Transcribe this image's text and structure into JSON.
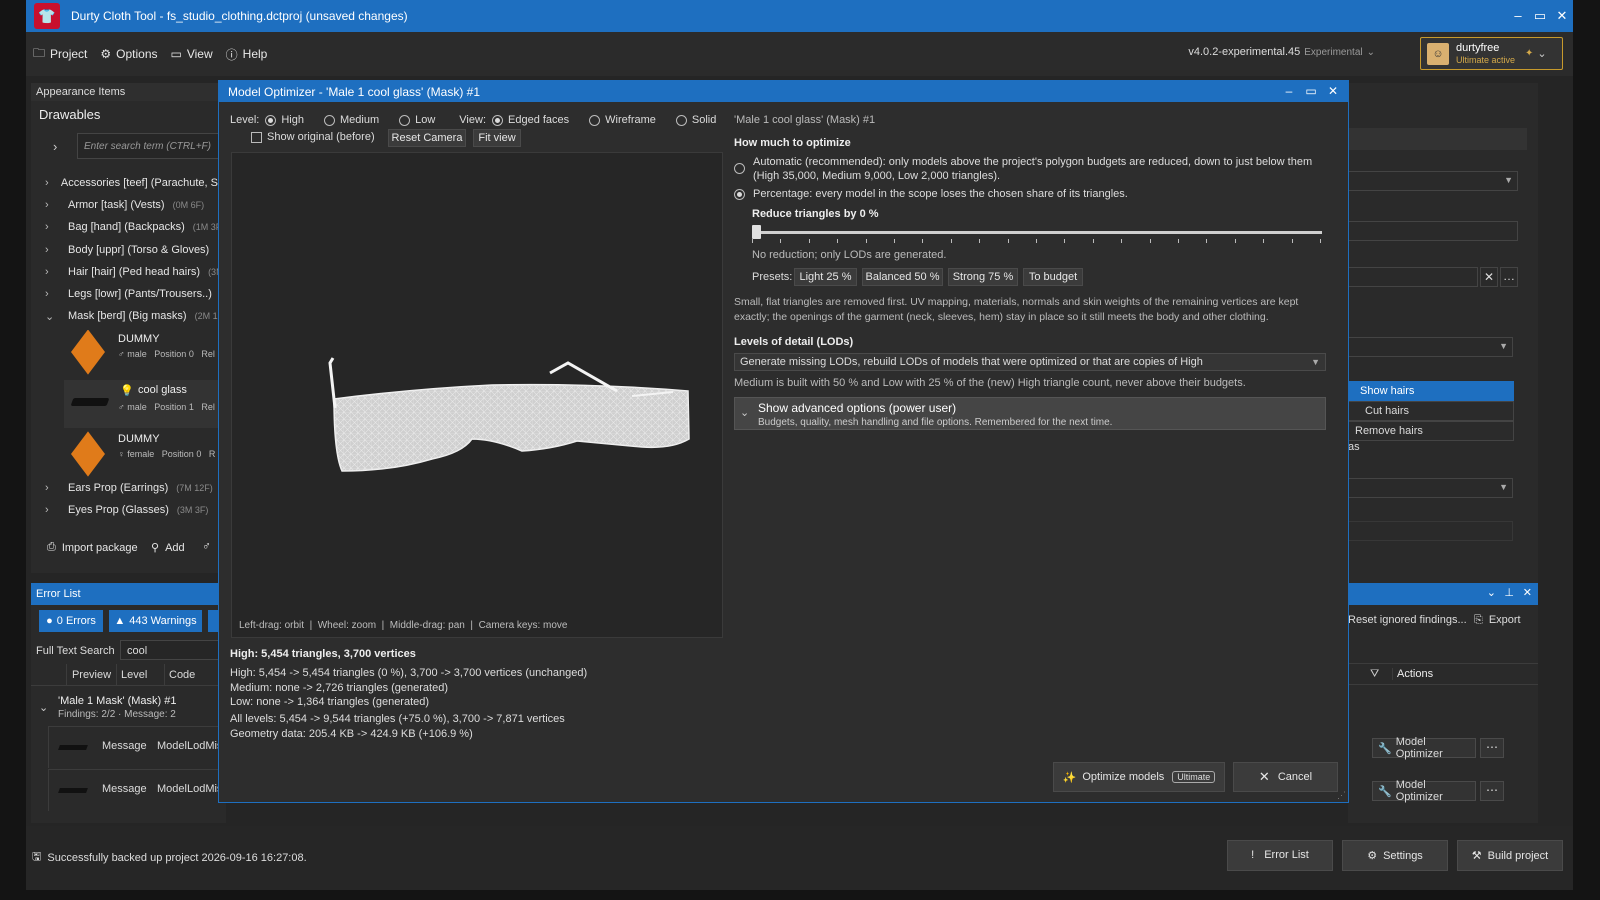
{
  "window": {
    "title": "Durty Cloth Tool - fs_studio_clothing.dctproj (unsaved changes)",
    "logo_icon": "tshirt-logo-icon",
    "controls": [
      "minimize-icon",
      "maximize-icon",
      "close-icon"
    ]
  },
  "menu": {
    "items": [
      {
        "label": "Project",
        "icon": "folder-icon"
      },
      {
        "label": "Options",
        "icon": "gear-icon"
      },
      {
        "label": "View",
        "icon": "view-icon"
      },
      {
        "label": "Help",
        "icon": "info-icon"
      }
    ],
    "version": "v4.0.2-experimental.45",
    "channel": "Experimental",
    "user": {
      "name": "durtyfree",
      "status": "Ultimate active"
    }
  },
  "appearance": {
    "panel_title": "Appearance Items",
    "section": "Drawables",
    "search_placeholder": "Enter search term (CTRL+F)",
    "tree": [
      {
        "label": "Accessories [teef] (Parachute, S",
        "count": ""
      },
      {
        "label": "Armor [task] (Vests)",
        "count": "(0M 6F)"
      },
      {
        "label": "Bag [hand] (Backpacks)",
        "count": "(1M 3F"
      },
      {
        "label": "Body [uppr] (Torso & Gloves)",
        "count": ""
      },
      {
        "label": "Hair [hair] (Ped head hairs)",
        "count": "(3M"
      },
      {
        "label": "Legs [lowr] (Pants/Trousers..)",
        "count": ""
      },
      {
        "label": "Mask [berd] (Big masks)",
        "count": "(2M 1F"
      }
    ],
    "cards": [
      {
        "name": "DUMMY",
        "gender": "male",
        "position_label": "Position",
        "position": "0",
        "extra": "Rel"
      },
      {
        "name": "cool glass",
        "gender": "male",
        "position_label": "Position",
        "position": "1",
        "extra": "Rel"
      },
      {
        "name": "DUMMY",
        "gender": "female",
        "position_label": "Position",
        "position": "0",
        "extra": "R"
      }
    ],
    "tree_after": [
      {
        "label": "Ears Prop (Earrings)",
        "count": "(7M 12F)"
      },
      {
        "label": "Eyes Prop (Glasses)",
        "count": "(3M 3F)"
      }
    ],
    "actions": {
      "import": "Import package",
      "add": "Add"
    }
  },
  "errors": {
    "panel_title": "Error List",
    "errors_btn": "0 Errors",
    "warnings_btn": "443 Warnings",
    "search_label": "Full Text Search",
    "search_value": "cool",
    "columns": [
      "Preview",
      "Level",
      "Code"
    ],
    "group": {
      "title": "'Male 1 Mask' (Mask) #1",
      "sub": "Findings: 2/2 · Message: 2"
    },
    "rows": [
      {
        "level": "Message",
        "code": "ModelLodMis"
      },
      {
        "level": "Message",
        "code": "ModelLodMis"
      }
    ],
    "right": {
      "reset": "Reset ignored findings...",
      "export": "Export",
      "actions_header": "Actions",
      "row_action": "Model Optimizer"
    }
  },
  "right_panel": {
    "dropdown_items": [
      "Show hairs",
      "Cut hairs",
      "Remove hairs"
    ],
    "fragment": "as"
  },
  "dialog": {
    "title": "Model Optimizer - 'Male 1 cool glass' (Mask) #1",
    "level_label": "Level:",
    "levels": [
      "High",
      "Medium",
      "Low"
    ],
    "view_label": "View:",
    "views": [
      "Edged faces",
      "Wireframe",
      "Solid"
    ],
    "show_original": "Show original (before)",
    "reset_camera": "Reset Camera",
    "fit_view": "Fit view",
    "viewport_hint": "Left-drag: orbit  |  Wheel: zoom  |  Middle-drag: pan  |  Camera keys: move",
    "model_name": "'Male 1 cool glass' (Mask) #1",
    "how_much": "How much to optimize",
    "auto_option_1": "Automatic (recommended): only models above the project's polygon budgets are reduced, down to just below them",
    "auto_option_2": "(High 35,000, Medium 9,000, Low 2,000 triangles).",
    "pct_option": "Percentage: every model in the scope loses the chosen share of its triangles.",
    "reduce_label": "Reduce triangles by 0 %",
    "reduce_value": 0,
    "no_reduction": "No reduction; only LODs are generated.",
    "presets_label": "Presets:",
    "presets": [
      "Light 25 %",
      "Balanced 50 %",
      "Strong 75 %",
      "To budget"
    ],
    "desc_1": "Small, flat triangles are removed first. UV mapping, materials, normals and skin weights of the remaining vertices are kept",
    "desc_2": "exactly; the openings of the garment (neck, sleeves, hem) stay in place so it still meets the body and other clothing.",
    "lods_label": "Levels of detail (LODs)",
    "lods_select": "Generate missing LODs, rebuild LODs of models that were optimized or that are copies of High",
    "lods_note": "Medium is built with 50 % and Low with 25 % of the (new) High triangle count, never above their budgets.",
    "advanced_title": "Show advanced options (power user)",
    "advanced_sub": "Budgets, quality, mesh handling and file options. Remembered for the next time.",
    "stats_head": "High: 5,454 triangles, 3,700 vertices",
    "stats": [
      "High: 5,454 -> 5,454 triangles (0 %), 3,700 -> 3,700 vertices (unchanged)",
      "Medium: none -> 2,726 triangles (generated)",
      "Low: none -> 1,364 triangles (generated)"
    ],
    "stats_all": "All levels: 5,454 -> 9,544 triangles (+75.0 %), 3,700 -> 7,871 vertices",
    "stats_geo": "Geometry data: 205.4 KB -> 424.9 KB (+106.9 %)",
    "optimize_btn": "Optimize models",
    "ultimate_badge": "Ultimate",
    "cancel_btn": "Cancel"
  },
  "statusbar": {
    "message": "Successfully backed up project 2026-09-16 16:27:08.",
    "buttons": [
      "Error List",
      "Settings",
      "Build project"
    ]
  }
}
